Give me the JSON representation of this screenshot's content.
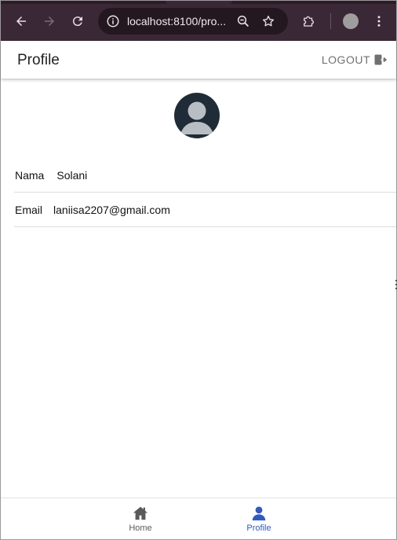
{
  "browser": {
    "url": "localhost:8100/pro...",
    "icons": [
      "back-icon",
      "forward-icon",
      "reload-icon",
      "site-info-icon",
      "zoom-icon",
      "bookmark-star-icon",
      "extensions-icon",
      "profile-avatar-icon",
      "menu-icon"
    ]
  },
  "header": {
    "title": "Profile",
    "logout_label": "LOGOUT"
  },
  "profile": {
    "fields": [
      {
        "label": "Nama",
        "value": "Solani"
      },
      {
        "label": "Email",
        "value": "laniisa2207@gmail.com"
      }
    ]
  },
  "tabs": [
    {
      "label": "Home",
      "icon": "home-icon",
      "active": false
    },
    {
      "label": "Profile",
      "icon": "person-icon",
      "active": true
    }
  ],
  "colors": {
    "chrome": "#3b2836",
    "accent": "#2f5ac4",
    "avatar_bg": "#1f2c38"
  }
}
